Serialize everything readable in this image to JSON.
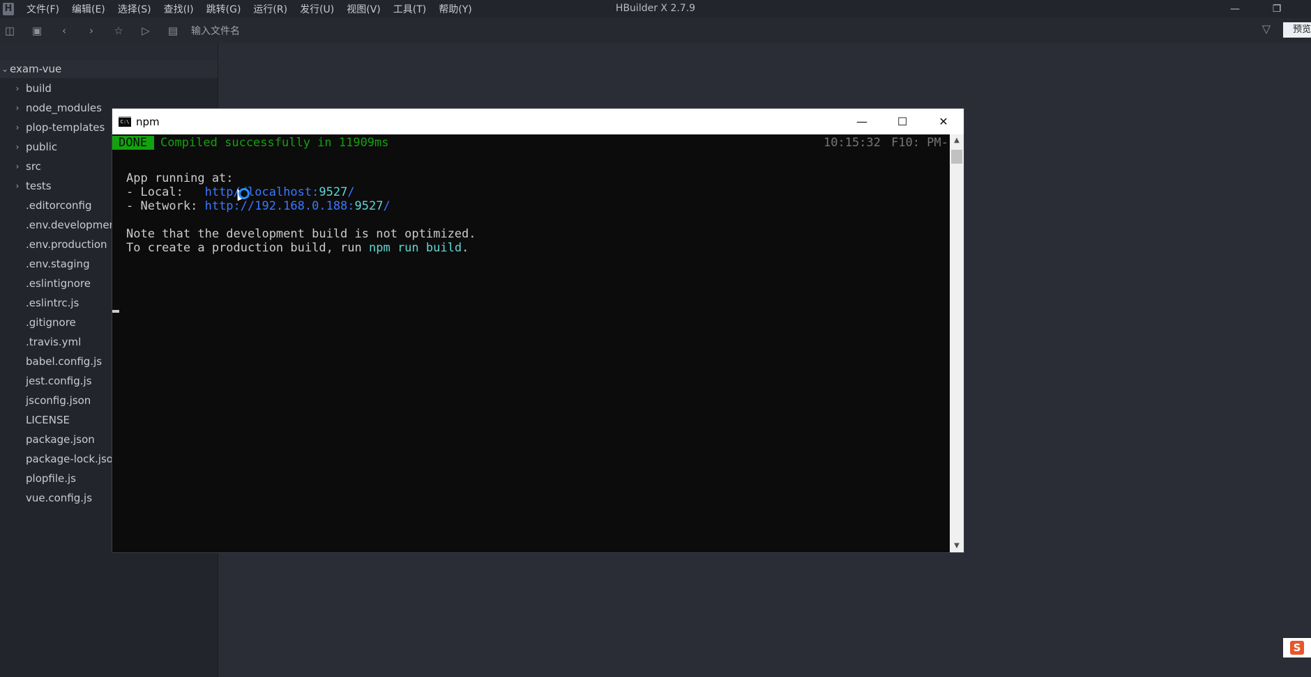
{
  "app": {
    "title": "HBuilder X 2.7.9",
    "menu": [
      "文件(F)",
      "编辑(E)",
      "选择(S)",
      "查找(I)",
      "跳转(G)",
      "运行(R)",
      "发行(U)",
      "视图(V)",
      "工具(T)",
      "帮助(Y)"
    ]
  },
  "toolbar": {
    "file_input_placeholder": "输入文件名",
    "preview_label": "预览"
  },
  "sidebar": {
    "root": "exam-vue",
    "folders": [
      "build",
      "node_modules",
      "plop-templates",
      "public",
      "src",
      "tests"
    ],
    "files": [
      ".editorconfig",
      ".env.developmen",
      ".env.production",
      ".env.staging",
      ".eslintignore",
      ".eslintrc.js",
      ".gitignore",
      ".travis.yml",
      "babel.config.js",
      "jest.config.js",
      "jsconfig.json",
      "LICENSE",
      "package.json",
      "package-lock.json",
      "plopfile.js",
      "vue.config.js"
    ]
  },
  "terminal": {
    "window_title": "npm",
    "done_label": "DONE",
    "compiled_msg": "Compiled successfully in 11909ms",
    "time": "10:15:32",
    "time_suffix": "F10: PM-",
    "running_label": "App running at:",
    "local_prefix": "- Local:   ",
    "local_url_a": "http",
    "local_url_b": "//localhost:",
    "local_port": "9527",
    "local_slash": "/",
    "network_prefix": "- Network: ",
    "network_url": "http://192.168.0.188:",
    "network_port": "9527",
    "network_slash": "/",
    "note_line": "Note that the development build is not optimized.",
    "create_prefix": "To create a production build, run ",
    "create_cmd": "npm run build",
    "create_suffix": "."
  },
  "colors": {
    "terminal_green": "#13a10e",
    "terminal_blue": "#3b78ff",
    "terminal_cyan": "#61d6d6"
  }
}
